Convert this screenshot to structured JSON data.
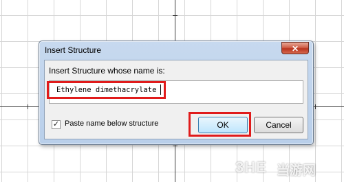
{
  "dialog": {
    "title": "Insert Structure",
    "close_icon": "close-icon",
    "prompt": "Insert Structure whose name is:",
    "name_value": "Ethylene dimethacrylate",
    "paste_checkbox": {
      "checked": true,
      "label": "Paste name below structure"
    },
    "ok_label": "OK",
    "cancel_label": "Cancel"
  },
  "annotations": {
    "highlight_color": "#e01b1b"
  },
  "watermark": {
    "brand": "3HE",
    "name": "当游网"
  }
}
